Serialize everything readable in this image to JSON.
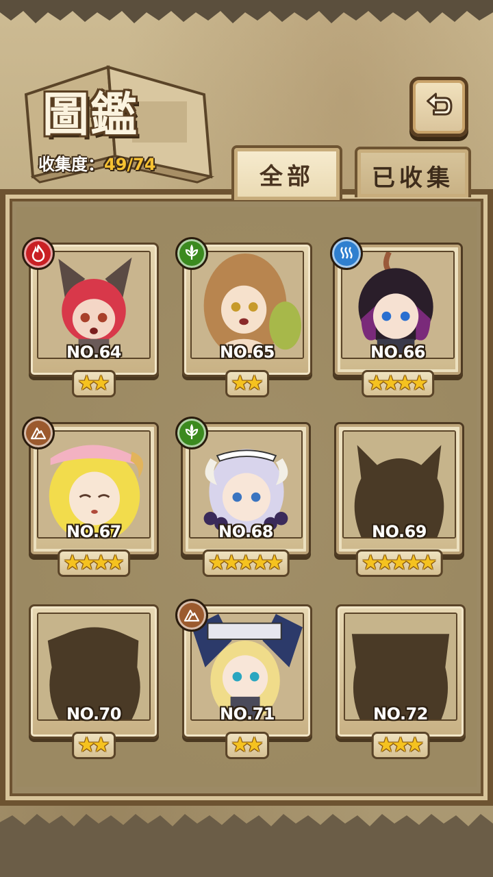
{
  "header": {
    "title": "圖鑑",
    "collection_label": "收集度：",
    "collection_count": "49/74"
  },
  "tabs": [
    {
      "label": "全部",
      "active": true
    },
    {
      "label": "已收集",
      "active": false
    }
  ],
  "colors": {
    "fire": "#c91f24",
    "wood": "#3b8a1f",
    "water": "#2f7fcf",
    "earth": "#9b5a2e",
    "star": "#f5c21f",
    "count_accent": "#f6c233"
  },
  "cards": [
    {
      "number": "NO.64",
      "stars": 2,
      "element": "fire-icon",
      "collected": true
    },
    {
      "number": "NO.65",
      "stars": 2,
      "element": "leaf-icon",
      "collected": true
    },
    {
      "number": "NO.66",
      "stars": 4,
      "element": "water-icon",
      "collected": true
    },
    {
      "number": "NO.67",
      "stars": 4,
      "element": "mountain-icon",
      "collected": true
    },
    {
      "number": "NO.68",
      "stars": 5,
      "element": "leaf-icon",
      "collected": true
    },
    {
      "number": "NO.69",
      "stars": 5,
      "element": null,
      "collected": false
    },
    {
      "number": "NO.70",
      "stars": 2,
      "element": null,
      "collected": false
    },
    {
      "number": "NO.71",
      "stars": 2,
      "element": "mountain-icon",
      "collected": true
    },
    {
      "number": "NO.72",
      "stars": 3,
      "element": null,
      "collected": false
    }
  ]
}
